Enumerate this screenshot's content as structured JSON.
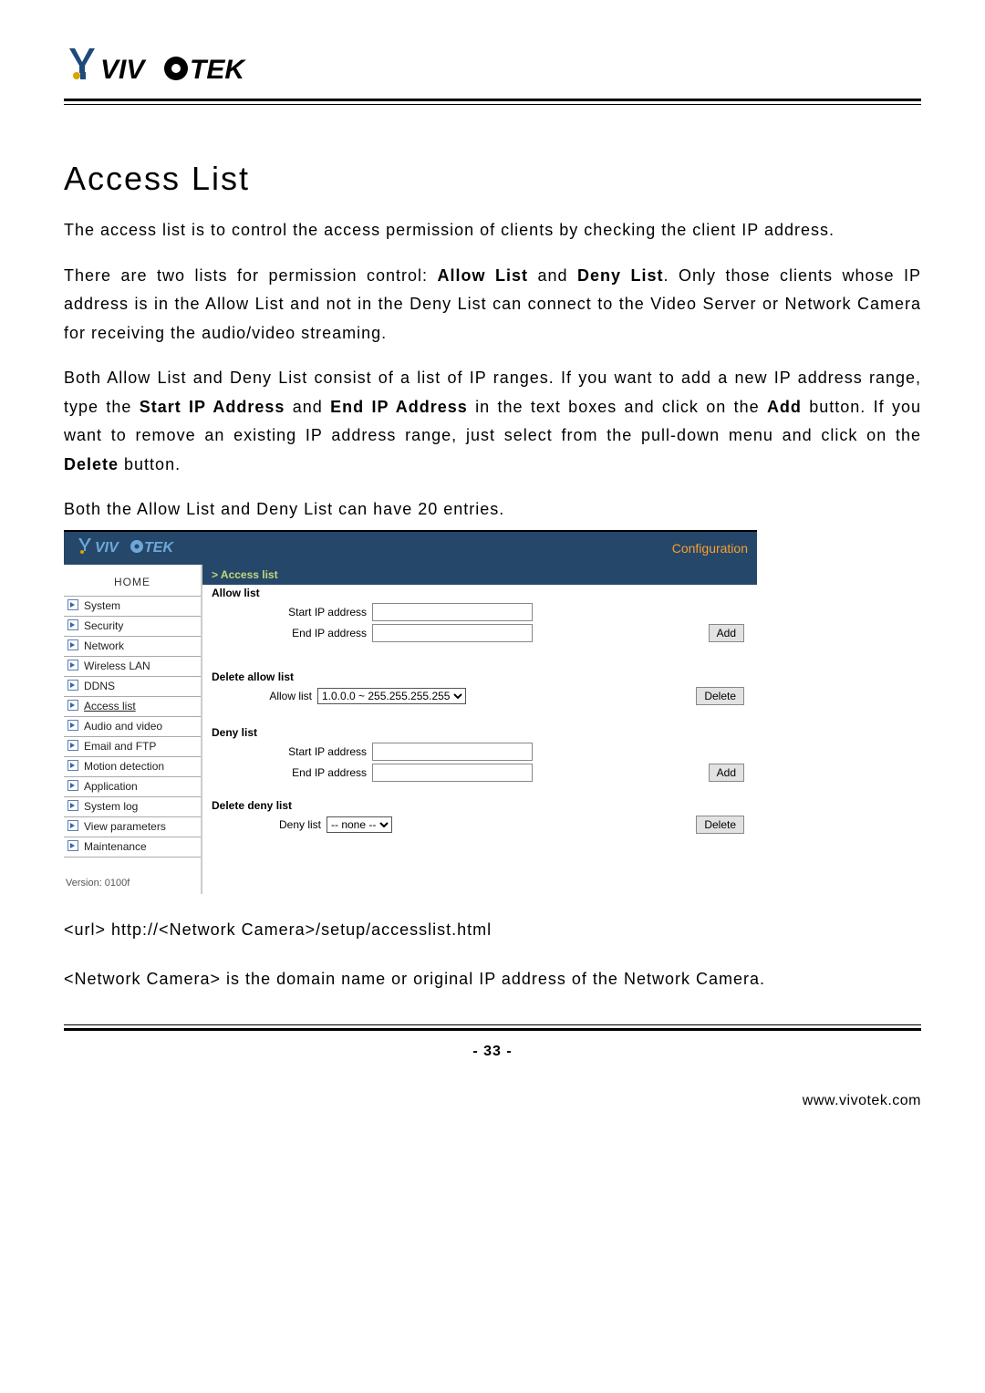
{
  "header": {
    "logo_text": "VIVOTEK"
  },
  "section": {
    "title": "Access List",
    "paragraphs": {
      "p1": "The access list is to control the access permission of clients by checking the client IP address.",
      "p2_pre": "There are two lists for permission control: ",
      "p2_b1": "Allow List",
      "p2_mid": " and ",
      "p2_b2": "Deny List",
      "p2_post": ". Only those clients whose IP address is in the Allow List and not in the Deny List can connect to the Video Server or Network Camera for receiving the audio/video streaming.",
      "p3_pre": "Both Allow List and Deny List consist of a list of IP ranges. If you want to add a new IP address range, type the ",
      "p3_b1": "Start IP Address",
      "p3_mid": " and ",
      "p3_b2": "End IP Address",
      "p3_mid2": " in the text boxes and click on the ",
      "p3_b3": "Add",
      "p3_mid3": " button. If you want to remove an existing IP address range, just select from the pull-down menu and click on the ",
      "p3_b4": "Delete",
      "p3_post": " button.",
      "p4": "Both the Allow List and Deny List can have 20 entries."
    }
  },
  "shot": {
    "brand": "VIVOTEK",
    "config_label": "Configuration",
    "nav": {
      "home": "HOME",
      "items": [
        {
          "label": "System"
        },
        {
          "label": "Security"
        },
        {
          "label": "Network"
        },
        {
          "label": "Wireless LAN"
        },
        {
          "label": "DDNS"
        },
        {
          "label": "Access list",
          "current": true
        },
        {
          "label": "Audio and video"
        },
        {
          "label": "Email and FTP"
        },
        {
          "label": "Motion detection"
        },
        {
          "label": "Application"
        },
        {
          "label": "System log"
        },
        {
          "label": "View parameters"
        },
        {
          "label": "Maintenance"
        }
      ],
      "version": "Version: 0100f"
    },
    "crumb": "> Access list",
    "allow": {
      "heading": "Allow list",
      "start_label": "Start IP address",
      "end_label": "End IP address",
      "add_btn": "Add",
      "delete_heading": "Delete allow list",
      "list_label": "Allow list",
      "selected": "1.0.0.0 ~ 255.255.255.255",
      "delete_btn": "Delete"
    },
    "deny": {
      "heading": "Deny list",
      "start_label": "Start IP address",
      "end_label": "End IP address",
      "add_btn": "Add",
      "delete_heading": "Delete deny list",
      "list_label": "Deny list",
      "selected": "-- none --",
      "delete_btn": "Delete"
    }
  },
  "url_section": {
    "line1": "<url> http://<Network Camera>/setup/accesslist.html",
    "line2": "<Network Camera> is the domain name or original IP address of the Network Camera."
  },
  "footer": {
    "page_number": "- 33 -",
    "site": "www.vivotek.com"
  }
}
